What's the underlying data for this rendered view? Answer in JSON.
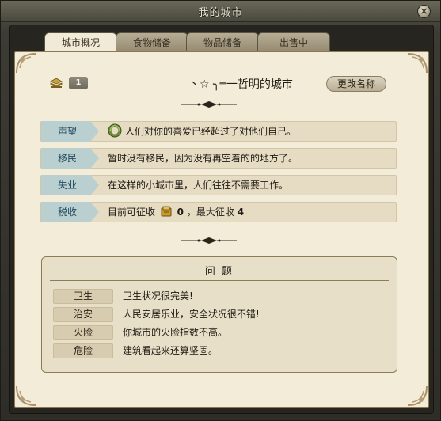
{
  "window": {
    "title": "我的城市",
    "close_label": "×"
  },
  "tabs": [
    {
      "label": "城市概况",
      "active": true
    },
    {
      "label": "食物储备",
      "active": false
    },
    {
      "label": "物品储备",
      "active": false
    },
    {
      "label": "出售中",
      "active": false
    }
  ],
  "header": {
    "level": "1",
    "city_name": "丶☆ ╮═一哲明的城市",
    "rename_label": "更改名称"
  },
  "stats": [
    {
      "label": "声望",
      "text": "人们对你的喜爱已经超过了对他们自己。"
    },
    {
      "label": "移民",
      "text": "暂时没有移民，因为没有再空着的的地方了。"
    },
    {
      "label": "失业",
      "text": "在这样的小城市里，人们往往不需要工作。"
    },
    {
      "label": "税收",
      "text_before": "目前可征收",
      "current_tax": "0",
      "text_mid": "，最大征收",
      "max_tax": "4"
    }
  ],
  "issues": {
    "title": "问 题",
    "rows": [
      {
        "key": "卫生",
        "value": "卫生状况很完美!"
      },
      {
        "key": "治安",
        "value": "人民安居乐业，安全状况很不错!"
      },
      {
        "key": "火险",
        "value": "你城市的火险指数不高。"
      },
      {
        "key": "危险",
        "value": "建筑看起来还算坚固。"
      }
    ]
  },
  "colors": {
    "panel_bg": "#f3ecd9",
    "label_text": "#244a5e",
    "label_bg": "#b9cfd0",
    "frame_bg": "#26251f"
  },
  "icons": {
    "level": "stack-icon",
    "reputation": "laurel-icon",
    "tax": "gold-coin-icon",
    "close": "close-icon"
  }
}
